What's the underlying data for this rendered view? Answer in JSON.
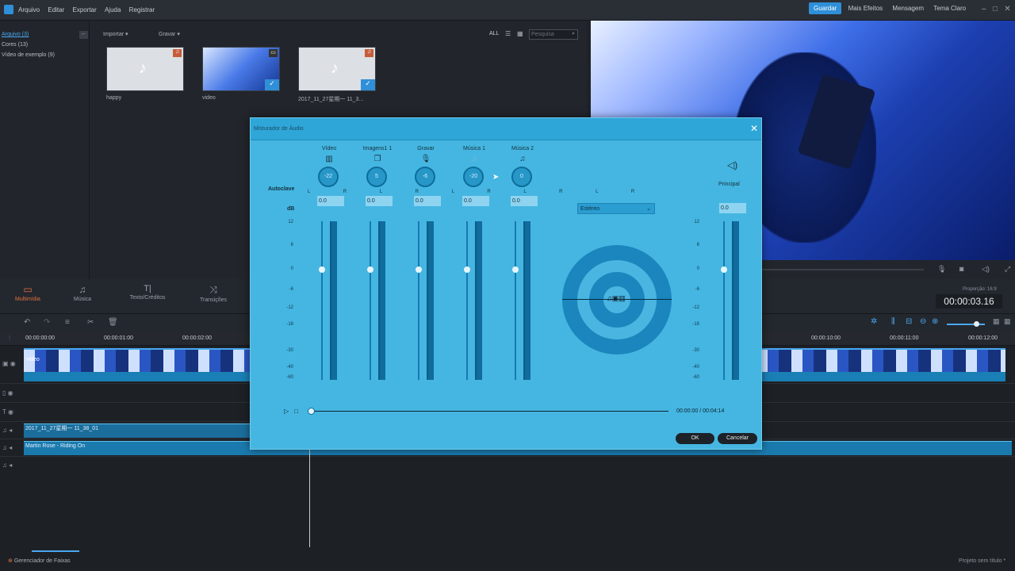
{
  "menu": {
    "items": [
      "Arquivo",
      "Editar",
      "Exportar",
      "Ajuda",
      "Registrar"
    ]
  },
  "top_right": {
    "save": "Guardar",
    "effects": "Mais Efeitos",
    "messages": "Mensagem",
    "theme": "Tema Claro"
  },
  "sidebar": {
    "items": [
      "Arquivo (3)",
      "Cores (13)",
      "Vídeo de exemplo (9)"
    ]
  },
  "library": {
    "import": "Importar",
    "record": "Gravar",
    "filter_all": "ALL",
    "search_placeholder": "Pesquisa",
    "media": [
      {
        "name": "happy",
        "type": "music-icon"
      },
      {
        "name": "video",
        "type": "video-icon"
      },
      {
        "name": "2017_11_27星期一 11_3...",
        "type": "music-icon"
      }
    ]
  },
  "tabs": [
    "Multimídia",
    "Música",
    "Texto/Créditos",
    "Transições"
  ],
  "preview": {
    "aspect": "Proporção: 16:9",
    "timecode": "00:00:03.16"
  },
  "ruler": {
    "left": [
      "00:00:00:00",
      "00:00:01:00",
      "00:00:02:00"
    ],
    "right": [
      "00:00:10:00",
      "00:00:11:00",
      "00:00:12:00"
    ]
  },
  "tracks": {
    "video_label": "video",
    "audio1": "2017_11_27星期一 11_38_01",
    "audio2": "Martin Rose - Riding On"
  },
  "bottom": {
    "track_manager": "Gerenciador de Faixas",
    "project": "Projeto sem título *"
  },
  "mixer": {
    "title": "Misturador de Áudio",
    "autoclave": "Autoclave",
    "db": "dB",
    "channels": [
      {
        "name": "Vídeo",
        "icon": "film-icon",
        "knob": "-22",
        "db": "0.0"
      },
      {
        "name": "Imagens1 1",
        "icon": "images-icon",
        "knob": "5",
        "db": "0.0"
      },
      {
        "name": "Gravar",
        "icon": "microphone-icon",
        "knob": "-6",
        "db": "0.0"
      },
      {
        "name": "Música 1",
        "icon": "music-note-icon",
        "knob": "-20",
        "db": "0.0"
      },
      {
        "name": "Música 2",
        "icon": "music-note-icon",
        "knob": "0",
        "db": "0.0"
      }
    ],
    "scale": [
      "12",
      "6",
      "0",
      "-6",
      "-12",
      "-18",
      "-30",
      "-40",
      "-60"
    ],
    "mode": "Estéreo",
    "principal": "Principal",
    "principal_db": "0.0",
    "time": "00:00:00 / 00:04:14",
    "ok": "OK",
    "cancel": "Cancelar"
  }
}
